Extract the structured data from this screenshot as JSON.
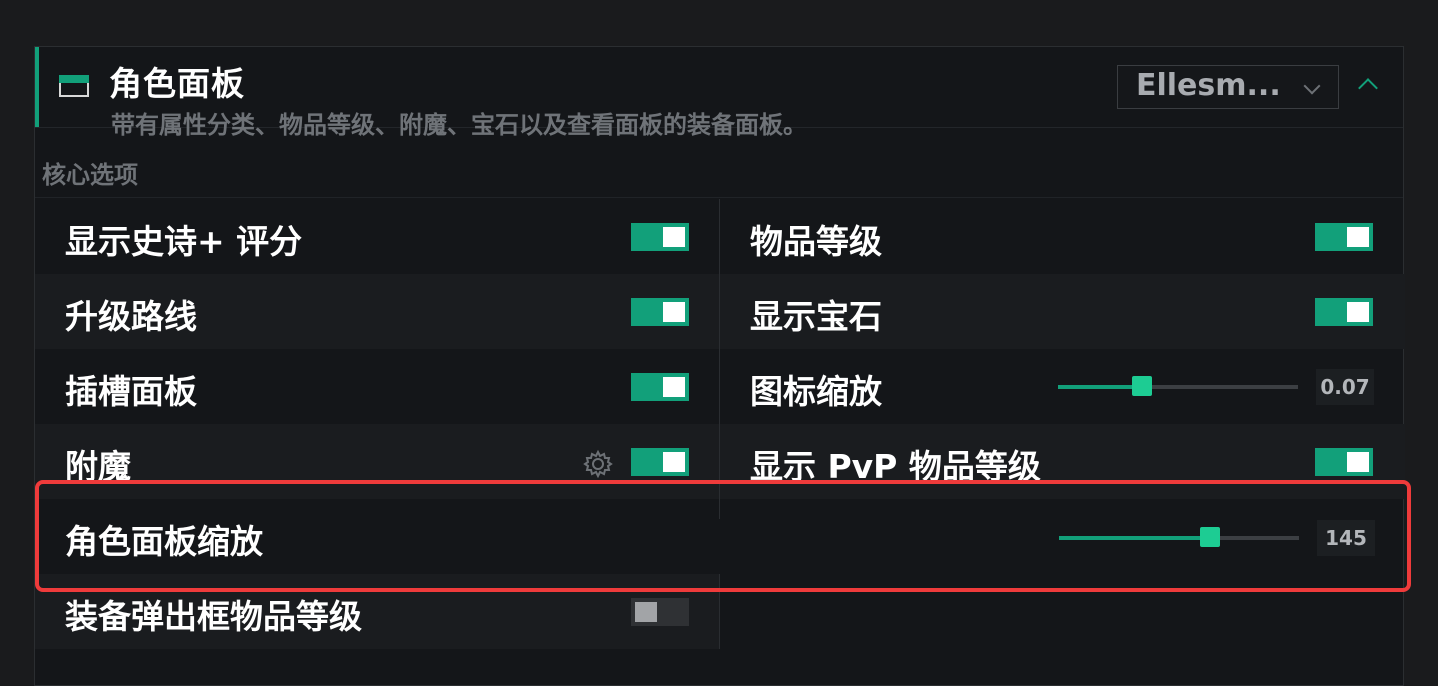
{
  "panel": {
    "title": "角色面板",
    "subtitle": "带有属性分类、物品等级、附魔、宝石以及查看面板的装备面板。",
    "profile_dropdown": "Ellesm...",
    "section_label": "核心选项"
  },
  "options": {
    "show_mplus_score": "显示史诗+ 评分",
    "item_level": "物品等级",
    "upgrade_track": "升级路线",
    "show_gems": "显示宝石",
    "socket_panel": "插槽面板",
    "icon_scale": "图标缩放",
    "icon_scale_value": "0.07",
    "enchant": "附魔",
    "show_pvp_item_level": "显示 PvP 物品等级",
    "character_panel_scale": "角色面板缩放",
    "character_panel_scale_value": "145",
    "flyout_item_level": "装备弹出框物品等级"
  },
  "toggles": {
    "show_mplus_score": true,
    "item_level": true,
    "upgrade_track": true,
    "show_gems": true,
    "socket_panel": true,
    "enchant": true,
    "show_pvp_item_level": true,
    "flyout_item_level": false
  },
  "sliders": {
    "icon_scale_fraction": 0.35,
    "character_panel_scale_fraction": 0.63
  },
  "colors": {
    "accent": "#12a07a",
    "highlight": "#ef3b3b"
  },
  "icons": [
    "panel-icon",
    "chevron-down-icon",
    "chevron-up-icon",
    "gear-icon"
  ]
}
